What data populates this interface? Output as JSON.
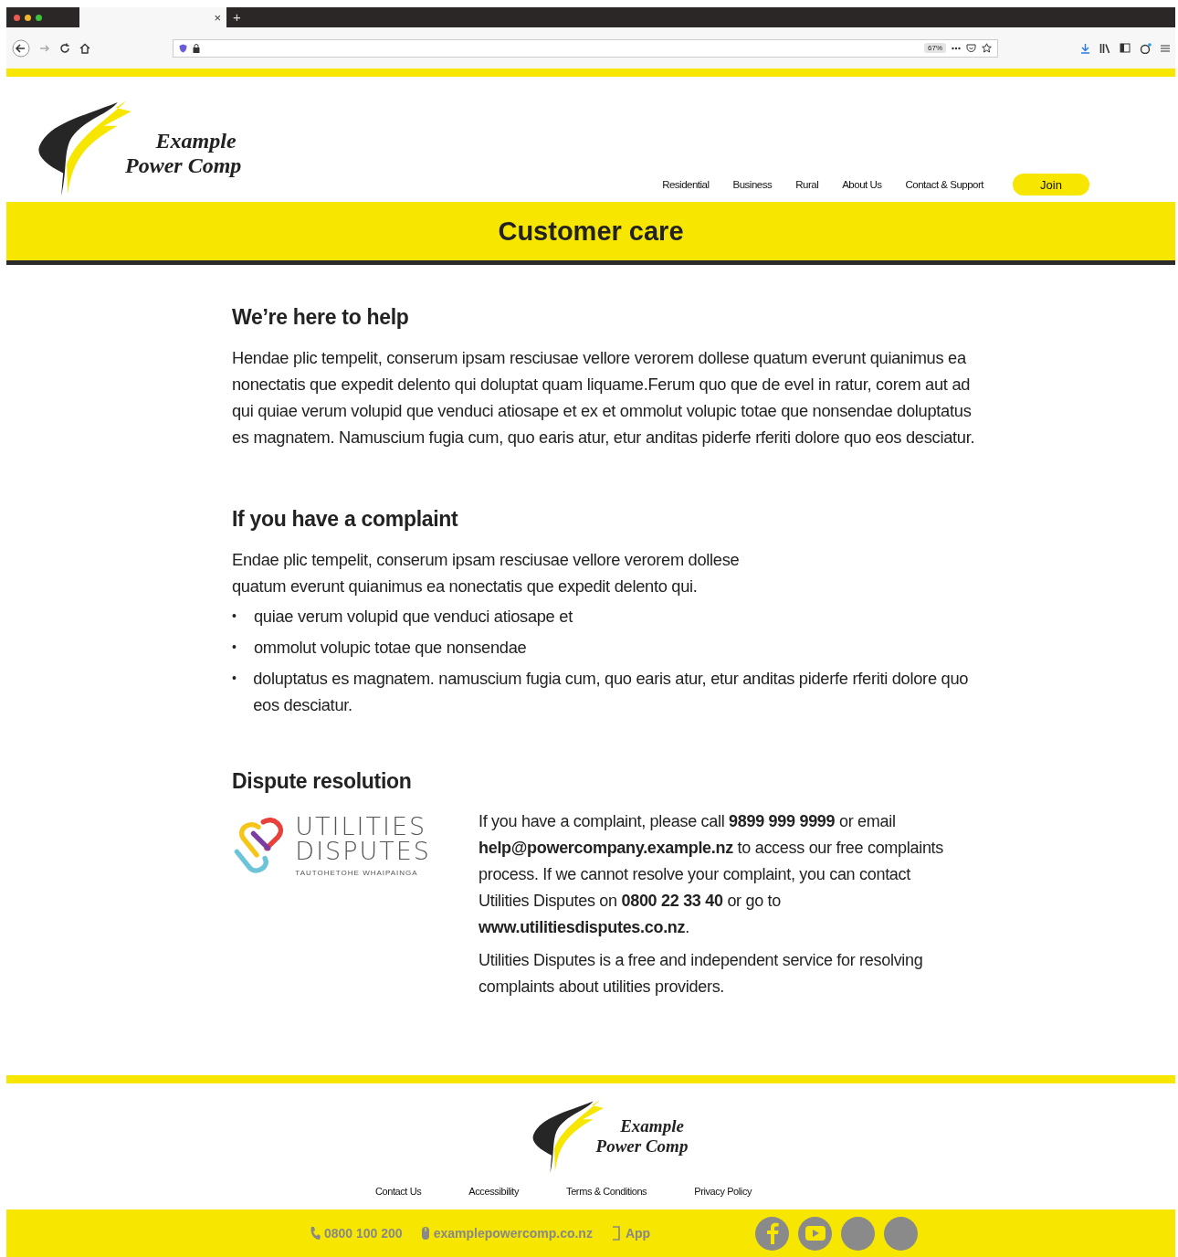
{
  "browser": {
    "tab_close": "×",
    "new_tab": "+",
    "zoom": "67%"
  },
  "header": {
    "logo": {
      "line1": "Example",
      "line2": "Power Comp"
    },
    "nav": [
      {
        "label": "Residential"
      },
      {
        "label": "Business"
      },
      {
        "label": "Rural"
      },
      {
        "label": "About Us"
      },
      {
        "label": "Contact & Support"
      }
    ],
    "join_button": "Join"
  },
  "banner": {
    "title": "Customer care"
  },
  "intro": {
    "heading": "We’re here to help",
    "paragraph": "Hendae plic tempelit, conserum ipsam resciusae vellore verorem dollese quatum everunt quianimus ea nonectatis que expedit delento qui doluptat quam liquame.Ferum quo que de evel in ratur, corem aut ad qui quiae verum volupid que venduci atiosape et ex et ommolut volupic totae que nonsendae doluptatus es magnatem. Namuscium fugia cum, quo earis atur, etur anditas piderfe rferiti dolore quo eos desciatur."
  },
  "complaint": {
    "heading": "If you have a complaint",
    "lines": [
      "Endae plic tempelit, conserum ipsam resciusae vellore verorem dollese",
      "quatum everunt quianimus ea nonectatis que expedit delento qui."
    ],
    "bullet": "•",
    "bullets": [
      "quiae verum volupid que venduci atiosape et",
      "ommolut volupic totae que nonsendae",
      "doluptatus es magnatem. namuscium fugia cum, quo earis atur, etur anditas piderfe rferiti dolore quo eos desciatur."
    ]
  },
  "dispute": {
    "heading": "Dispute resolution",
    "partner_logo": {
      "line1": "UTILITIES",
      "line2": "DISPUTES",
      "tagline": "TAUTOHETOHE WHAIPAINGA"
    },
    "paragraphs": [
      "If you have a complaint, please call **9899 999 9999** or email **help@powercompany.example.nz** to access our free complaints process. If we cannot resolve your complaint, you can contact Utilities Disputes on **0800 22 33 40** or go to **www.utilitiesdisputes.co.nz**.",
      "Utilities Disputes is a free and independent service for resolving complaints about utilities providers."
    ]
  },
  "footer": {
    "logo": {
      "line1": "Example",
      "line2": "Power Comp"
    },
    "links": [
      {
        "label": "Contact Us"
      },
      {
        "label": "Accessibility"
      },
      {
        "label": "Terms & Conditions"
      },
      {
        "label": "Privacy Policy"
      }
    ],
    "contacts": [
      {
        "kind": "phone",
        "text": "0800 100 200"
      },
      {
        "kind": "email",
        "text": "examplepowercomp.co.nz"
      },
      {
        "kind": "app",
        "text": "App"
      }
    ],
    "social": [
      {
        "kind": "facebook"
      },
      {
        "kind": "youtube"
      },
      {
        "kind": "plain"
      },
      {
        "kind": "plain"
      }
    ]
  }
}
